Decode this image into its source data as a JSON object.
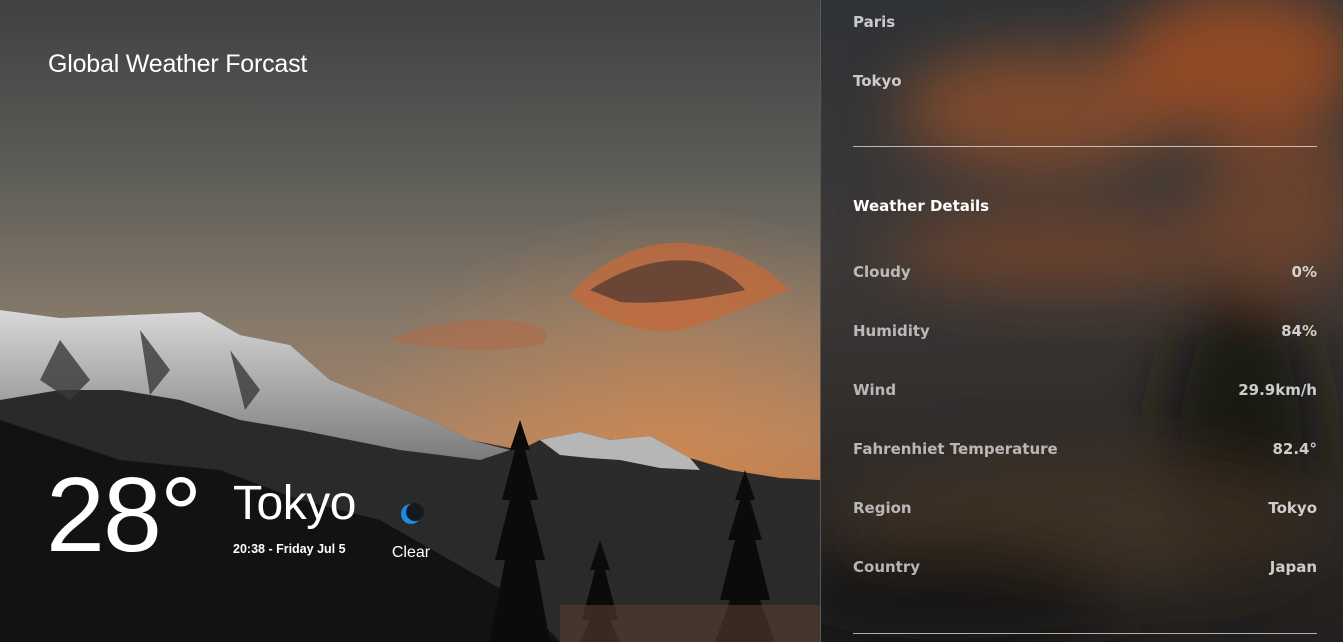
{
  "app": {
    "brand": "Global Weather Forcast"
  },
  "current": {
    "temperature": "28°",
    "city": "Tokyo",
    "datetime": "20:38 - Friday Jul 5",
    "condition": "Clear",
    "condition_icon": "moon-icon"
  },
  "panel": {
    "cities": [
      {
        "label": "Paris"
      },
      {
        "label": "Tokyo"
      }
    ],
    "details_title": "Weather Details",
    "details": [
      {
        "label": "Cloudy",
        "value": "0%"
      },
      {
        "label": "Humidity",
        "value": "84%"
      },
      {
        "label": "Wind",
        "value": "29.9km/h"
      },
      {
        "label": "Fahrenhiet Temperature",
        "value": "82.4°"
      },
      {
        "label": "Region",
        "value": "Tokyo"
      },
      {
        "label": "Country",
        "value": "Japan"
      }
    ]
  },
  "colors": {
    "accent_icon": "#1e88e5",
    "text": "#ffffff"
  }
}
